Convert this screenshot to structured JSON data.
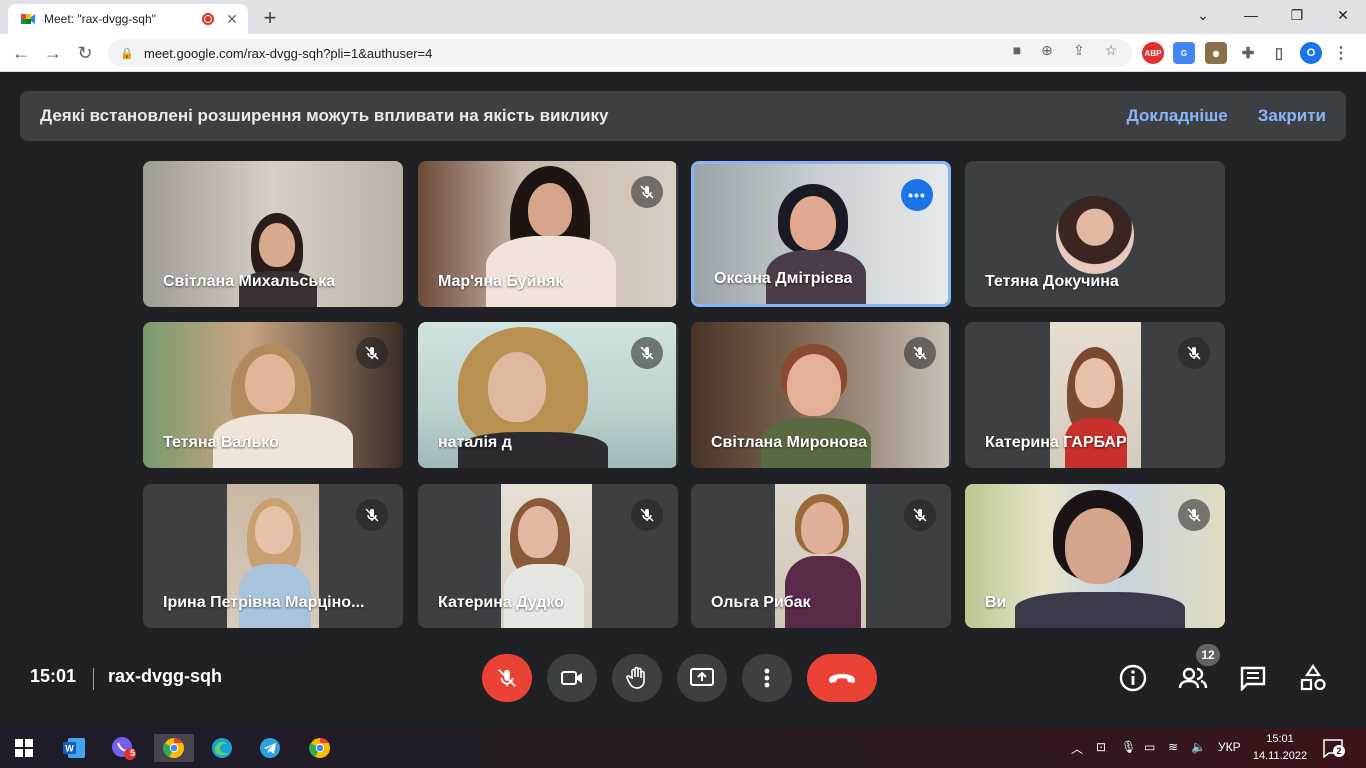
{
  "browser": {
    "tab_title": "Meet: \"rax-dvgg-sqh\"",
    "url": "meet.google.com/rax-dvgg-sqh?pli=1&authuser=4",
    "profile_letter": "O",
    "extensions": [
      "ABP",
      "translate",
      "owl",
      "puzzle"
    ],
    "window_controls": [
      "minimize",
      "restore",
      "close"
    ]
  },
  "banner": {
    "message": "Деякі встановлені розширення можуть впливати на якість виклику",
    "learn_more": "Докладніше",
    "close": "Закрити"
  },
  "participants": [
    {
      "name": "Світлана Михальська",
      "muted": false
    },
    {
      "name": "Мар'яна Буйняк",
      "muted": true
    },
    {
      "name": "Оксана Дмітрієва",
      "muted": false,
      "active": true
    },
    {
      "name": "Тетяна Докучина",
      "muted": false,
      "avatar": true
    },
    {
      "name": "Тетяна Валько",
      "muted": true
    },
    {
      "name": "наталія д",
      "muted": true
    },
    {
      "name": "Світлана Миронова",
      "muted": true
    },
    {
      "name": "Катерина ГАРБАР",
      "muted": true
    },
    {
      "name": "Ірина Петрівна Марціно...",
      "muted": true
    },
    {
      "name": "Катерина Дудко",
      "muted": true
    },
    {
      "name": "Ольга Рибак",
      "muted": true
    },
    {
      "name": "Ви",
      "muted": true
    }
  ],
  "meeting": {
    "time": "15:01",
    "code": "rax-dvgg-sqh",
    "participant_count": "12"
  },
  "taskbar": {
    "language": "УКР",
    "time": "15:01",
    "date": "14.11.2022",
    "viber_badge": "5",
    "notification_count": "2"
  }
}
